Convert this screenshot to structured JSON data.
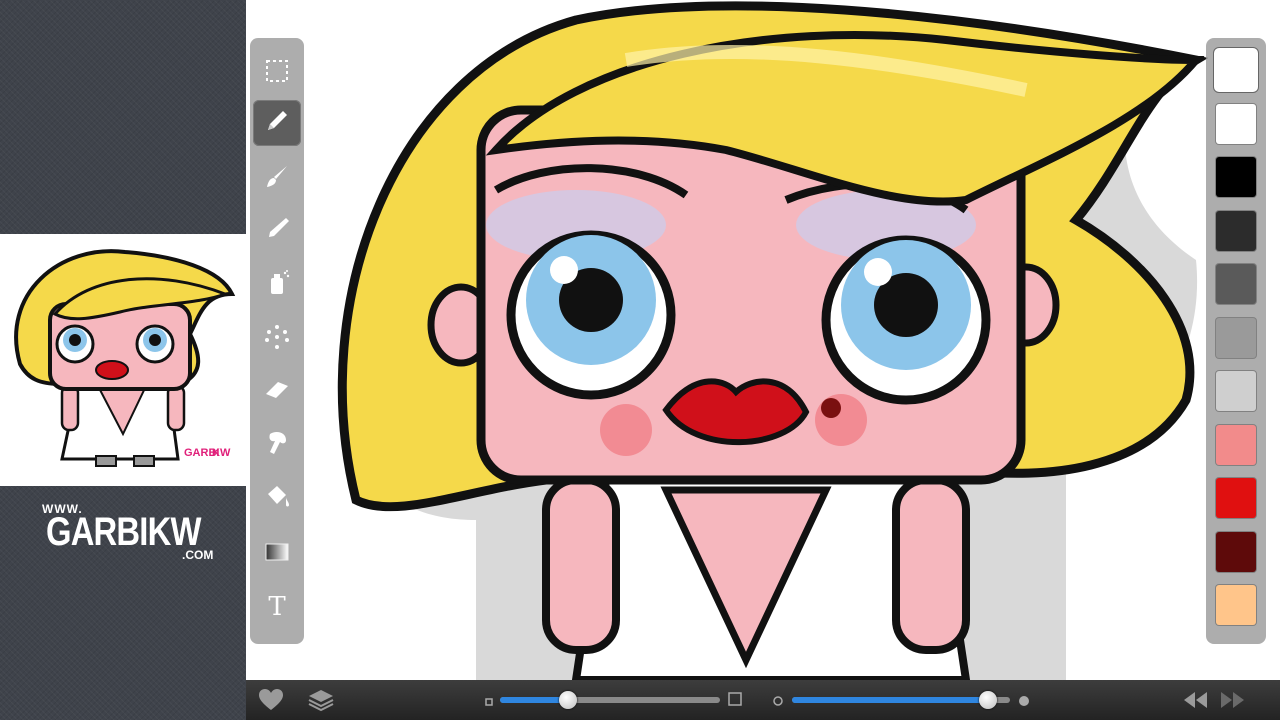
{
  "branding": {
    "www": "WWW.",
    "name": "GARBIKW",
    "tld": ".COM"
  },
  "tools": [
    {
      "name": "selection-tool",
      "icon": "dashed-selection-icon",
      "active": false
    },
    {
      "name": "pencil-tool",
      "icon": "pencil-icon",
      "active": true
    },
    {
      "name": "brush-tool",
      "icon": "brush-icon",
      "active": false
    },
    {
      "name": "marker-tool",
      "icon": "marker-icon",
      "active": false
    },
    {
      "name": "spray-tool",
      "icon": "spray-can-icon",
      "active": false
    },
    {
      "name": "scatter-tool",
      "icon": "scatter-dots-icon",
      "active": false
    },
    {
      "name": "eraser-tool",
      "icon": "eraser-icon",
      "active": false
    },
    {
      "name": "smudge-tool",
      "icon": "smudge-finger-icon",
      "active": false
    },
    {
      "name": "fill-tool",
      "icon": "paint-bucket-icon",
      "active": false
    },
    {
      "name": "gradient-tool",
      "icon": "gradient-icon",
      "active": false
    },
    {
      "name": "text-tool",
      "icon": "text-icon",
      "label": "T",
      "active": false
    }
  ],
  "colors": [
    "#ffffff",
    "#ffffff",
    "#000000",
    "#2c2c2c",
    "#5a5a5a",
    "#9a9a9a",
    "#cfcfcf",
    "#f28b8b",
    "#e01010",
    "#5e0a0a",
    "#ffc58a"
  ],
  "selected_color_index": 0,
  "bottom_bar": {
    "left_icons": [
      "heart-icon",
      "layers-icon"
    ],
    "size_slider": {
      "min_icon": "small-square-icon",
      "max_icon": "large-square-icon",
      "value": 0.31
    },
    "opacity_slider": {
      "min_icon": "small-circle-icon",
      "max_icon": "large-circle-icon",
      "value": 0.9
    },
    "right_icons": [
      "rewind-icon",
      "fast-forward-icon"
    ]
  },
  "accent": "#2f86e0"
}
